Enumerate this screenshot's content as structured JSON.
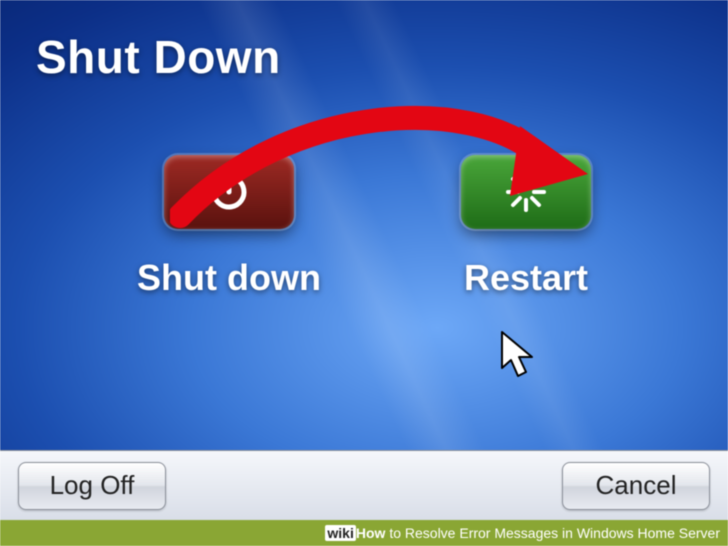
{
  "dialog": {
    "title": "Shut Down",
    "options": [
      {
        "label": "Shut down",
        "icon": "power-icon",
        "color": "red"
      },
      {
        "label": "Restart",
        "icon": "restart-icon",
        "color": "green"
      }
    ],
    "buttons": {
      "logoff": "Log Off",
      "cancel": "Cancel"
    }
  },
  "annotation": {
    "arrow_color": "#e30613",
    "target": "restart-button"
  },
  "watermark": {
    "brand_prefix": "wiki",
    "brand_suffix": "How",
    "rest": " to Resolve Error Messages in Windows Home Server"
  }
}
